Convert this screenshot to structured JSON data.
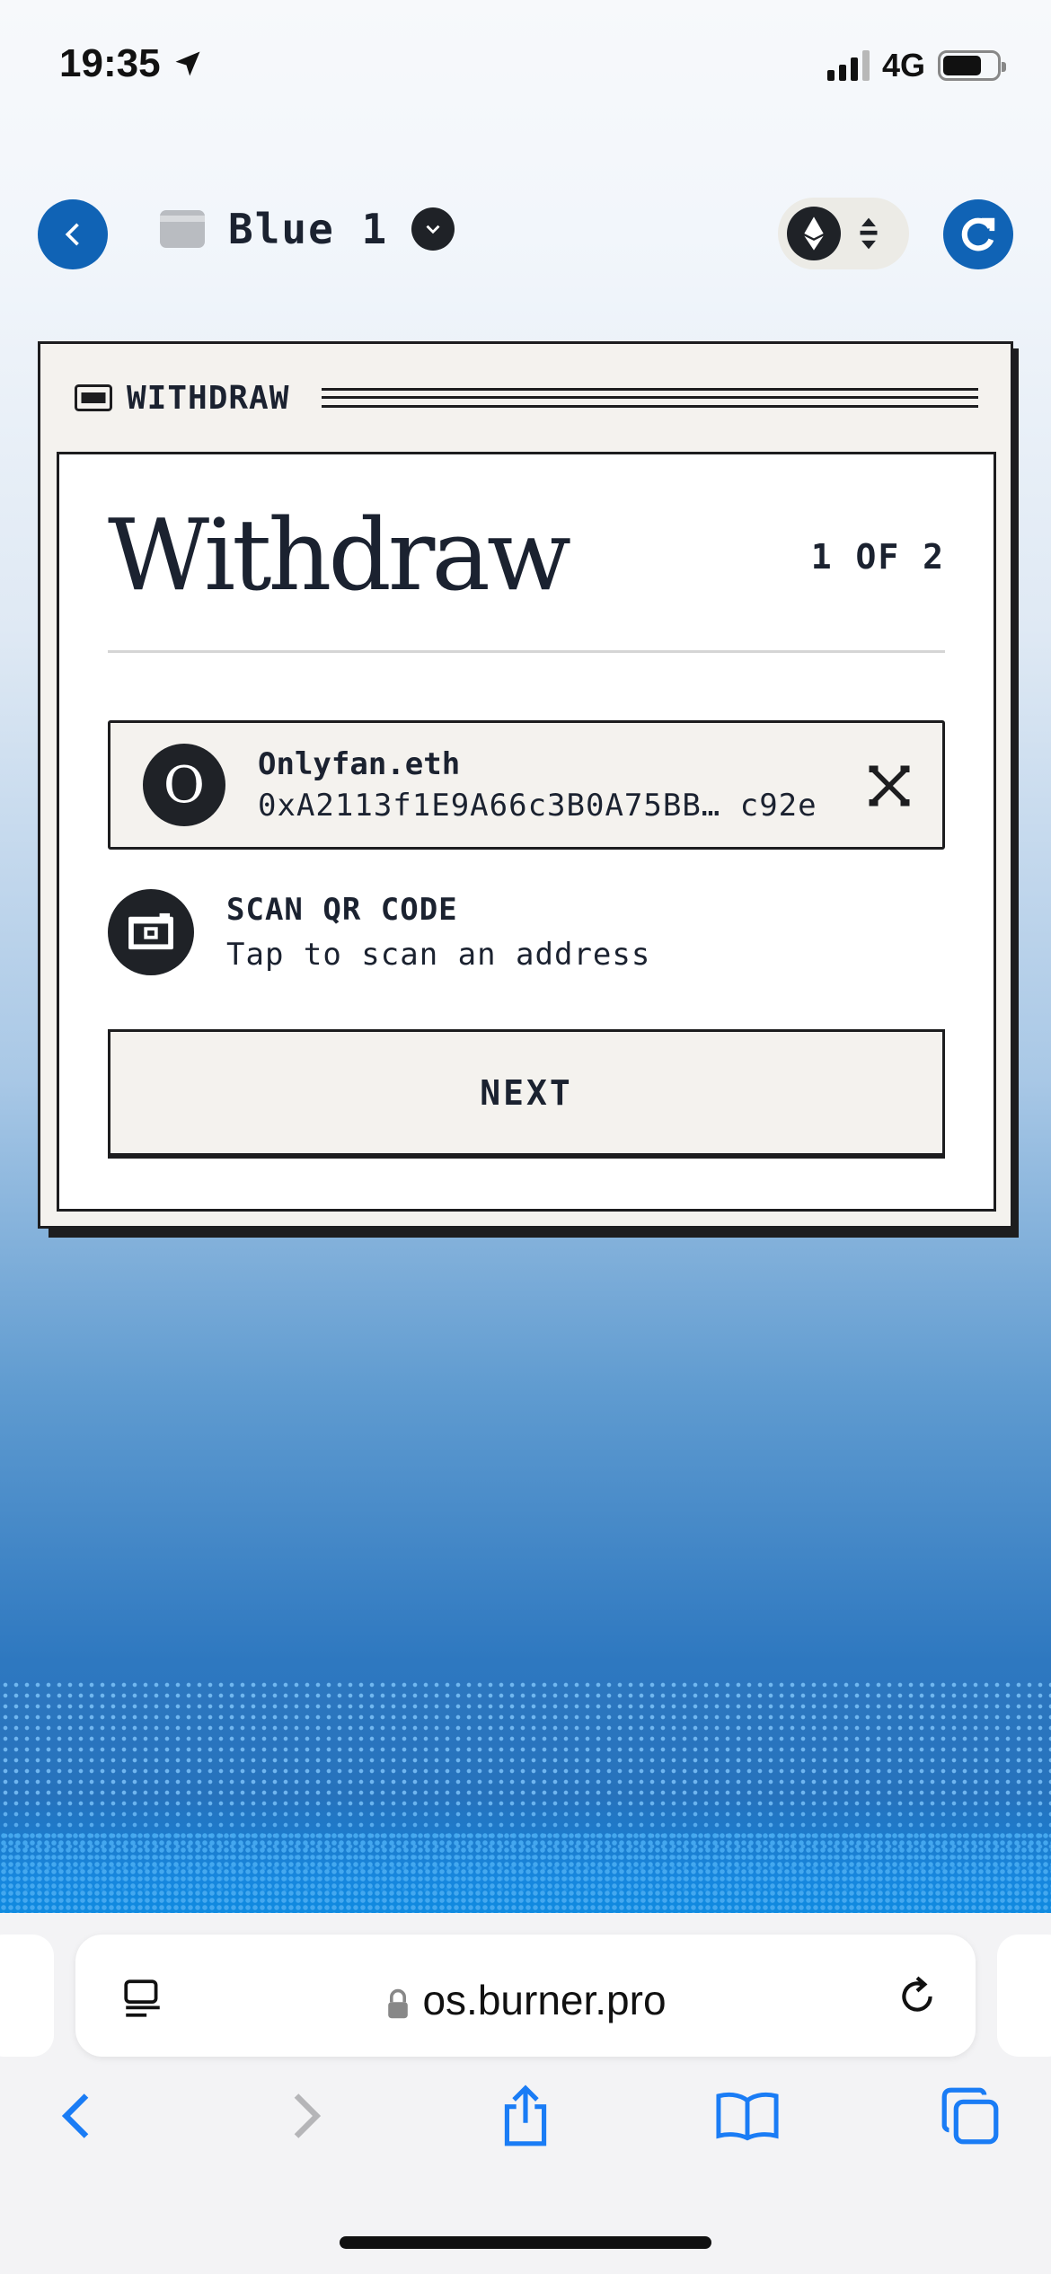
{
  "status_bar": {
    "time": "19:35",
    "network": "4G"
  },
  "header": {
    "wallet_name": "Blue 1",
    "eth_icon": "ethereum-icon",
    "accent_color": "#1063b5"
  },
  "card": {
    "window_title": "WITHDRAW",
    "heading": "Withdraw",
    "step_indicator": "1 OF 2",
    "recipient": {
      "avatar_letter": "O",
      "name": "Onlyfan.eth",
      "address": "0xA2113f1E9A66c3B0A75BB… c92e"
    },
    "scan": {
      "title": "SCAN QR CODE",
      "subtitle": "Tap to scan an address"
    },
    "next_label": "NEXT"
  },
  "browser": {
    "url": "os.burner.pro"
  }
}
